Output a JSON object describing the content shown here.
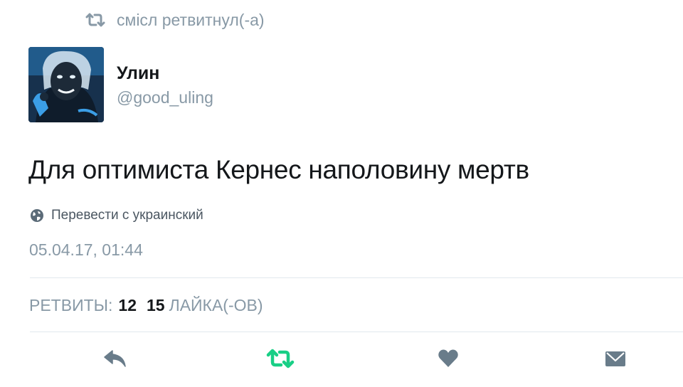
{
  "retweet_context": {
    "text": "смісл ретвитнул(-а)",
    "icon": "retweet-icon"
  },
  "author": {
    "name": "Улин",
    "handle": "@good_uling",
    "avatar": "avatar"
  },
  "tweet": {
    "text": "Для оптимиста Кернес наполовину мертв",
    "translate_label": "Перевести с украинский",
    "timestamp": "05.04.17, 01:44"
  },
  "stats": {
    "retweets_label": "РЕТВИТЫ:",
    "retweets_count": "12",
    "likes_count": "15",
    "likes_label": "ЛАЙКА(-ОВ)"
  },
  "actions": [
    {
      "name": "reply",
      "icon": "reply-icon"
    },
    {
      "name": "retweet",
      "icon": "retweet-icon",
      "active": true
    },
    {
      "name": "like",
      "icon": "heart-icon"
    },
    {
      "name": "direct-message",
      "icon": "envelope-icon"
    }
  ],
  "colors": {
    "secondary_text": "#8899a6",
    "primary_text": "#14171a",
    "retweet_active": "#19cf86",
    "action_icon": "#697c8a",
    "divider": "#e1e8ed"
  }
}
